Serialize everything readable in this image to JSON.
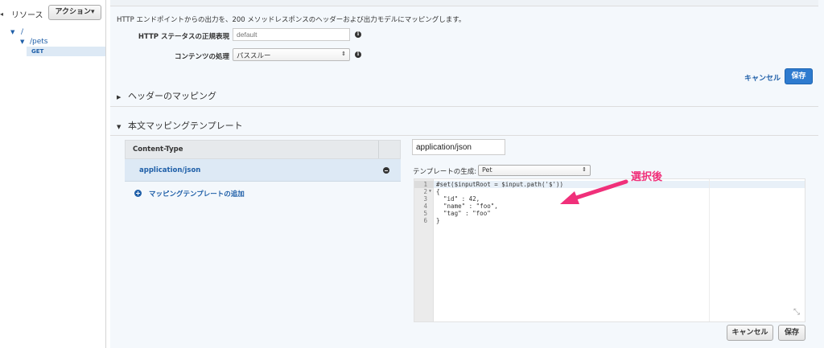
{
  "sidebar": {
    "collapse_glyph": "◂",
    "title": "リソース",
    "action_button": "アクション▾",
    "tree": [
      {
        "label": "/",
        "caret": "▼"
      },
      {
        "label": "/pets",
        "caret": "▼"
      },
      {
        "label": "GET"
      }
    ]
  },
  "integration": {
    "description": "HTTP エンドポイントからの出力を、200 メソッドレスポンスのヘッダーおよび出力モデルにマッピングします。",
    "regex_label": "HTTP ステータスの正規表現",
    "regex_placeholder": "default",
    "content_label": "コンテンツの処理",
    "content_value": "パススルー",
    "cancel_link": "キャンセル",
    "save_button": "保存"
  },
  "sections": {
    "headers_mapping": "ヘッダーのマッピング",
    "body_template": "本文マッピングテンプレート"
  },
  "content_type_table": {
    "header": "Content-Type",
    "rows": [
      "application/json"
    ],
    "add_label": "マッピングテンプレートの追加"
  },
  "template_editor": {
    "content_type_value": "application/json",
    "generate_label": "テンプレートの生成:",
    "generate_value": "Pet",
    "lines": [
      "#set($inputRoot = $input.path('$'))",
      "{",
      "  \"id\" : 42,",
      "  \"name\" : \"foo\",",
      "  \"tag\" : \"foo\"",
      "}"
    ],
    "line_numbers": [
      "1",
      "2",
      "3",
      "4",
      "5",
      "6"
    ]
  },
  "footer": {
    "cancel_button": "キャンセル",
    "save_button": "保存"
  },
  "annotation": {
    "label": "選択後",
    "color": "#f0307a"
  },
  "icons": {
    "info": "info-icon",
    "remove": "remove-icon",
    "add": "add-icon",
    "resize": "resize-icon",
    "resize_glyph": "⤡"
  },
  "colors": {
    "accent_blue": "#2e7bcf",
    "link_blue": "#1f5fa8",
    "selection_bg": "#dde9f5"
  }
}
